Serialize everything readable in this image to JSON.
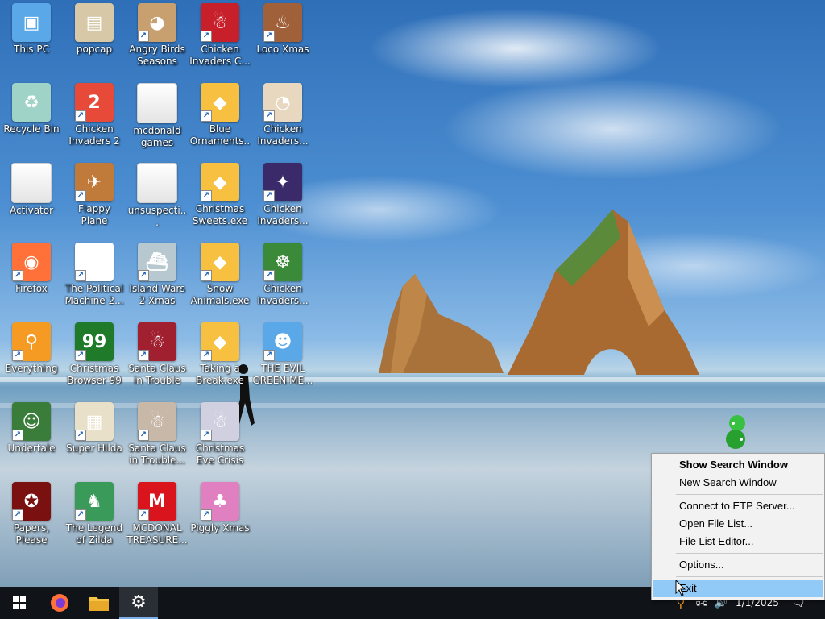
{
  "desktop": {
    "icons": [
      {
        "label": "This PC",
        "icon": "computer-icon",
        "color": "#5aa8e8",
        "glyph": "▣",
        "shortcut": false
      },
      {
        "label": "Recycle Bin",
        "icon": "recycle-bin-icon",
        "color": "#9fd3c7",
        "glyph": "♻",
        "shortcut": false
      },
      {
        "label": "Activator",
        "icon": "folder-icon",
        "color": "#f0f0f0",
        "glyph": "",
        "shortcut": false
      },
      {
        "label": "Firefox",
        "icon": "firefox-icon",
        "color": "#ff7139",
        "glyph": "◉",
        "shortcut": true
      },
      {
        "label": "Everything",
        "icon": "everything-search-icon",
        "color": "#f59a23",
        "glyph": "⚲",
        "shortcut": true
      },
      {
        "label": "Undertale",
        "icon": "undertale-icon",
        "color": "#3a7d3a",
        "glyph": "☺",
        "shortcut": true
      },
      {
        "label": "Papers, Please",
        "icon": "papers-please-icon",
        "color": "#7a1010",
        "glyph": "✪",
        "shortcut": true
      },
      {
        "label": "popcap",
        "icon": "popcap-icon",
        "color": "#d7c9a8",
        "glyph": "▤",
        "shortcut": false
      },
      {
        "label": "Chicken Invaders 2",
        "icon": "chicken-invaders-icon",
        "color": "#e84a3a",
        "glyph": "2",
        "shortcut": true
      },
      {
        "label": "Flappy Plane",
        "icon": "flappy-plane-icon",
        "color": "#c07a3a",
        "glyph": "✈",
        "shortcut": true
      },
      {
        "label": "The Political Machine 2...",
        "icon": "political-machine-icon",
        "color": "#ffffff",
        "glyph": "★",
        "shortcut": true
      },
      {
        "label": "Christmas Browser 99",
        "icon": "christmas-tree-icon",
        "color": "#1f7a2a",
        "glyph": "99",
        "shortcut": true
      },
      {
        "label": "Super Hilda",
        "icon": "super-hilda-icon",
        "color": "#e8e0c8",
        "glyph": "▦",
        "shortcut": true
      },
      {
        "label": "The Legend of Zilda",
        "icon": "legend-of-zilda-icon",
        "color": "#3a9a5a",
        "glyph": "♞",
        "shortcut": true
      },
      {
        "label": "Angry Birds Seasons",
        "icon": "angry-birds-icon",
        "color": "#c8a070",
        "glyph": "◕",
        "shortcut": true
      },
      {
        "label": "mcdonald games",
        "icon": "folder-icon",
        "color": "#f0f0f0",
        "glyph": "",
        "shortcut": false
      },
      {
        "label": "unsuspecti...",
        "icon": "folder-icon",
        "color": "#f0f0f0",
        "glyph": "",
        "shortcut": false
      },
      {
        "label": "Island Wars 2 Xmas",
        "icon": "island-wars-icon",
        "color": "#b8c8d0",
        "glyph": "⛴",
        "shortcut": true
      },
      {
        "label": "Santa Claus in Trouble",
        "icon": "santa-claus-icon",
        "color": "#a02030",
        "glyph": "☃",
        "shortcut": true
      },
      {
        "label": "Santa Claus in Trouble... A...",
        "icon": "santa-claus-icon",
        "color": "#c8b8a8",
        "glyph": "☃",
        "shortcut": true
      },
      {
        "label": "MCDONAL TREASURE...",
        "icon": "mcdonalds-icon",
        "color": "#d9141c",
        "glyph": "M",
        "shortcut": true
      },
      {
        "label": "Chicken Invaders C...",
        "icon": "chicken-invaders-icon",
        "color": "#c8202a",
        "glyph": "☃",
        "shortcut": true
      },
      {
        "label": "Blue Ornaments....",
        "icon": "generic-app-icon",
        "color": "#f8c040",
        "glyph": "◆",
        "shortcut": true
      },
      {
        "label": "Christmas Sweets.exe",
        "icon": "generic-app-icon",
        "color": "#f8c040",
        "glyph": "◆",
        "shortcut": true
      },
      {
        "label": "Snow Animals.exe",
        "icon": "generic-app-icon",
        "color": "#f8c040",
        "glyph": "◆",
        "shortcut": true
      },
      {
        "label": "Taking a Break.exe",
        "icon": "generic-app-icon",
        "color": "#f8c040",
        "glyph": "◆",
        "shortcut": true
      },
      {
        "label": "Christmas Eve Crisis",
        "icon": "santa-claus-icon",
        "color": "#d0d0e0",
        "glyph": "☃",
        "shortcut": true
      },
      {
        "label": "Piggly Xmas",
        "icon": "piggly-icon",
        "color": "#e080c0",
        "glyph": "♣",
        "shortcut": true
      },
      {
        "label": "Loco Xmas",
        "icon": "loco-bear-icon",
        "color": "#a0603a",
        "glyph": "♨",
        "shortcut": true
      },
      {
        "label": "Chicken Invaders...",
        "icon": "chicken-invaders-icon",
        "color": "#e8d8c0",
        "glyph": "◔",
        "shortcut": true
      },
      {
        "label": "Chicken Invaders...",
        "icon": "chicken-invaders-icon",
        "color": "#3a2a6a",
        "glyph": "✦",
        "shortcut": true
      },
      {
        "label": "Chicken Invaders...",
        "icon": "chicken-invaders-icon",
        "color": "#3a8a3a",
        "glyph": "☸",
        "shortcut": true
      },
      {
        "label": "THE EVIL GREEN ME...",
        "icon": "people-icon",
        "color": "#5aa8e8",
        "glyph": "☻",
        "shortcut": true
      }
    ]
  },
  "context_menu": {
    "items": [
      {
        "type": "item",
        "label": "Show Search Window",
        "bold": true
      },
      {
        "type": "item",
        "label": "New Search Window"
      },
      {
        "type": "separator"
      },
      {
        "type": "item",
        "label": "Connect to ETP Server..."
      },
      {
        "type": "item",
        "label": "Open File List..."
      },
      {
        "type": "item",
        "label": "File List Editor..."
      },
      {
        "type": "separator"
      },
      {
        "type": "item",
        "label": "Options..."
      },
      {
        "type": "separator"
      },
      {
        "type": "item",
        "label": "Exit",
        "hover": true
      }
    ]
  },
  "taskbar": {
    "pinned": [
      {
        "name": "start-button",
        "icon": "windows-logo-icon"
      },
      {
        "name": "firefox-taskbar-button",
        "icon": "firefox-icon"
      },
      {
        "name": "file-explorer-taskbar-button",
        "icon": "folder-icon"
      },
      {
        "name": "settings-taskbar-button",
        "icon": "gear-icon",
        "active": true
      }
    ],
    "clock": "1/1/2025",
    "colors": {
      "background": "#101418",
      "active_underline": "#7fb0e8"
    }
  }
}
